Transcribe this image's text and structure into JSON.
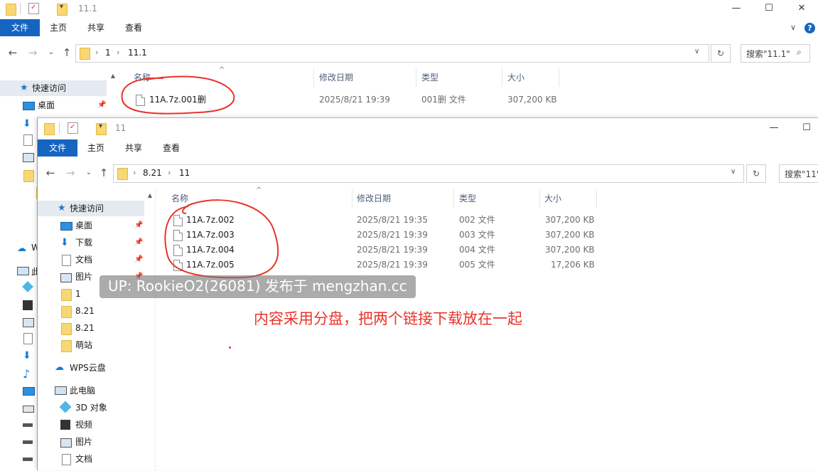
{
  "back_window": {
    "title": "11.1",
    "ribbon": {
      "file": "文件",
      "home": "主页",
      "share": "共享",
      "view": "查看"
    },
    "breadcrumb": [
      "1",
      "11.1"
    ],
    "search_placeholder": "搜索\"11.1\"",
    "nav": {
      "quick_access": "快速访问",
      "desktop": "桌面"
    },
    "columns": {
      "name": "名称",
      "date": "修改日期",
      "type": "类型",
      "size": "大小"
    },
    "files": [
      {
        "name": "11A.7z.001删",
        "date": "2025/8/21 19:39",
        "type": "001删 文件",
        "size": "307,200 KB"
      }
    ],
    "left_strip_labels": {
      "wps": "W",
      "pc": "此"
    }
  },
  "front_window": {
    "title": "11",
    "ribbon": {
      "file": "文件",
      "home": "主页",
      "share": "共享",
      "view": "查看"
    },
    "breadcrumb": [
      "8.21",
      "11"
    ],
    "search_placeholder": "搜索\"11\"",
    "nav": [
      {
        "label": "快速访问",
        "icon": "star-icon"
      },
      {
        "label": "桌面",
        "icon": "desktop-icon",
        "pinned": true
      },
      {
        "label": "下载",
        "icon": "download-icon",
        "pinned": true
      },
      {
        "label": "文档",
        "icon": "document-icon",
        "pinned": true
      },
      {
        "label": "图片",
        "icon": "pictures-icon",
        "pinned": true
      },
      {
        "label": "1",
        "icon": "folder-icon"
      },
      {
        "label": "8.21",
        "icon": "folder-icon"
      },
      {
        "label": "8.21",
        "icon": "folder-icon"
      },
      {
        "label": "萌站",
        "icon": "folder-icon"
      },
      {
        "label": "WPS云盘",
        "icon": "cloud-icon"
      },
      {
        "label": "此电脑",
        "icon": "computer-icon"
      },
      {
        "label": "3D 对象",
        "icon": "3d-objects-icon"
      },
      {
        "label": "视频",
        "icon": "video-icon"
      },
      {
        "label": "图片",
        "icon": "pictures-icon"
      },
      {
        "label": "文档",
        "icon": "document-icon"
      }
    ],
    "columns": {
      "name": "名称",
      "date": "修改日期",
      "type": "类型",
      "size": "大小"
    },
    "files": [
      {
        "name": "11A.7z.002",
        "date": "2025/8/21 19:35",
        "type": "002 文件",
        "size": "307,200 KB"
      },
      {
        "name": "11A.7z.003",
        "date": "2025/8/21 19:39",
        "type": "003 文件",
        "size": "307,200 KB"
      },
      {
        "name": "11A.7z.004",
        "date": "2025/8/21 19:39",
        "type": "004 文件",
        "size": "307,200 KB"
      },
      {
        "name": "11A.7z.005",
        "date": "2025/8/21 19:39",
        "type": "005 文件",
        "size": "17,206 KB"
      }
    ]
  },
  "overlay": {
    "watermark": "UP: RookieO2(26081) 发布于 mengzhan.cc",
    "annotation": "内容采用分盘，把两个链接下载放在一起"
  },
  "colors": {
    "accent": "#1565c0",
    "annotation": "#e8342a",
    "folder": "#f8d775"
  }
}
